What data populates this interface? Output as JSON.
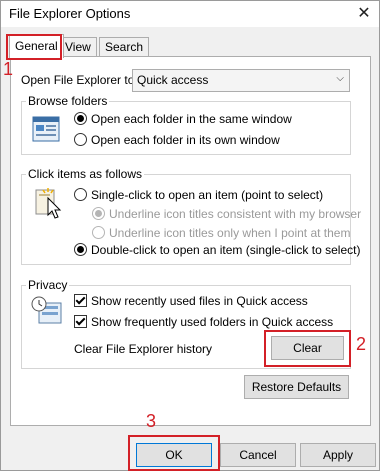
{
  "window": {
    "title": "File Explorer Options",
    "close_glyph": "✕"
  },
  "tabs": [
    {
      "label": "General",
      "active": true
    },
    {
      "label": "View"
    },
    {
      "label": "Search"
    }
  ],
  "annotations": {
    "step1": "1",
    "step2": "2",
    "step3": "3",
    "color": "#d32027"
  },
  "general": {
    "open_label": "Open File Explorer to:",
    "open_value": "Quick access",
    "browse_folders": {
      "title": "Browse folders",
      "same_window": "Open each folder in the same window",
      "own_window": "Open each folder in its own window",
      "selected": "same_window"
    },
    "click_items": {
      "title": "Click items as follows",
      "single_click": "Single-click to open an item (point to select)",
      "underline_consistent": "Underline icon titles consistent with my browser",
      "underline_point": "Underline icon titles only when I point at them",
      "double_click": "Double-click to open an item (single-click to select)",
      "selected": "double_click"
    },
    "privacy": {
      "title": "Privacy",
      "recent_files": "Show recently used files in Quick access",
      "frequent_folders": "Show frequently used folders in Quick access",
      "recent_files_checked": true,
      "frequent_folders_checked": true,
      "clear_history_label": "Clear File Explorer history",
      "clear_button": "Clear"
    },
    "restore_defaults": "Restore Defaults"
  },
  "footer": {
    "ok": "OK",
    "cancel": "Cancel",
    "apply": "Apply"
  }
}
